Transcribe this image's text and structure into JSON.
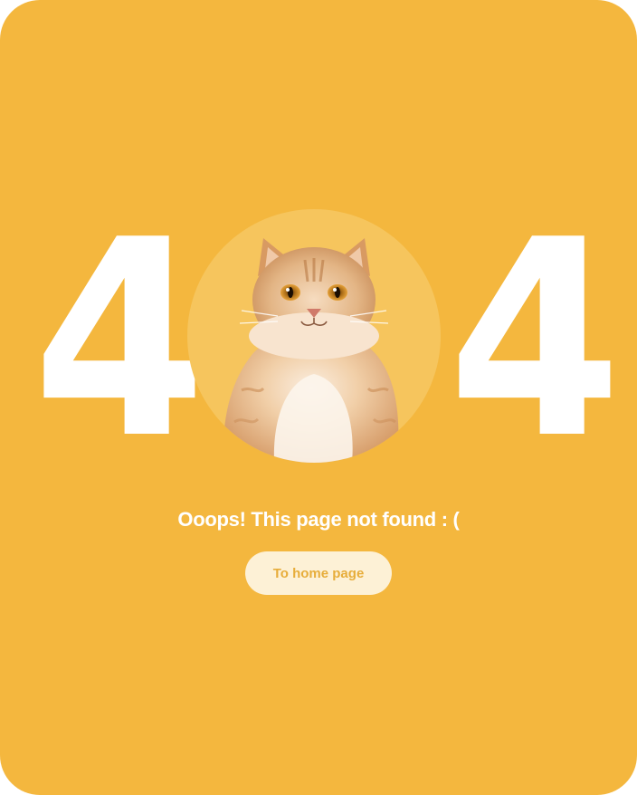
{
  "error": {
    "digit_left": "4",
    "digit_right": "4",
    "message": "Ooops! This page not found : (",
    "home_button_label": "To home page"
  },
  "colors": {
    "background": "#f4b73e",
    "circle": "#f6c55d",
    "text": "#ffffff",
    "button_bg": "#fdf1d6",
    "button_text": "#e7ad3a"
  },
  "icons": {
    "center_image": "cat-photo"
  }
}
